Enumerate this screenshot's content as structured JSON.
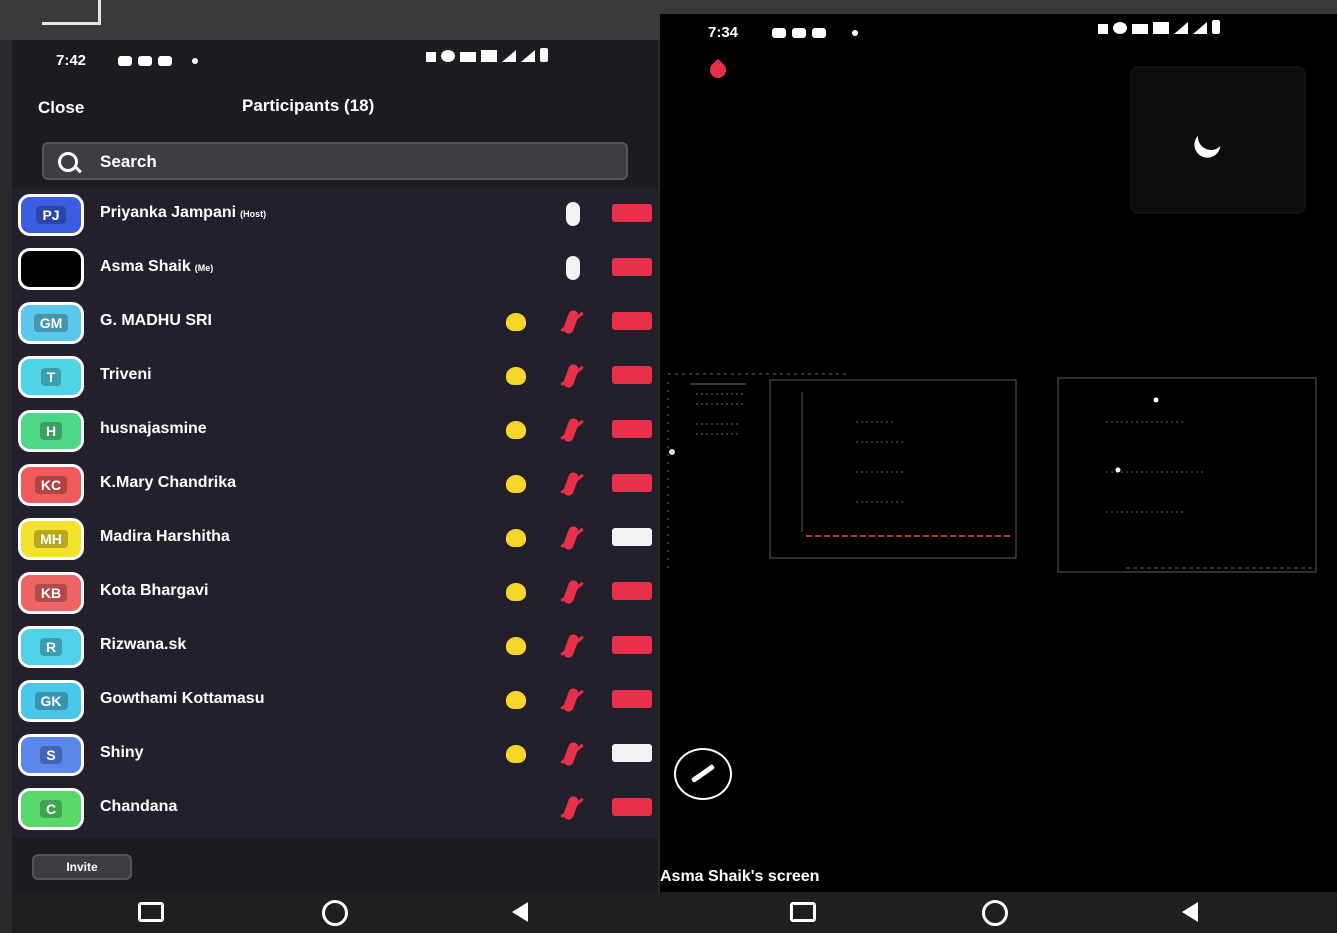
{
  "left_phone": {
    "status_time": "7:42",
    "close_label": "Close",
    "title": "Participants (18)",
    "search_placeholder": "Search",
    "invite_label": "Invite",
    "participants": [
      {
        "initials": "PJ",
        "name": "Priyanka Jampani",
        "tag": "(Host)",
        "avatar_color": "#3b5ee0",
        "hand": false,
        "mic": "on",
        "camera": "off"
      },
      {
        "initials": "",
        "name": "Asma Shaik",
        "tag": "(Me)",
        "avatar_color": "#000000",
        "hand": false,
        "mic": "on",
        "camera": "off"
      },
      {
        "initials": "GM",
        "name": "G. MADHU SRI",
        "tag": "",
        "avatar_color": "#5bc7ea",
        "hand": true,
        "mic": "off",
        "camera": "off"
      },
      {
        "initials": "T",
        "name": "Triveni",
        "tag": "",
        "avatar_color": "#4fd4e6",
        "hand": true,
        "mic": "off",
        "camera": "off"
      },
      {
        "initials": "H",
        "name": "husnajasmine",
        "tag": "",
        "avatar_color": "#4ed687",
        "hand": true,
        "mic": "off",
        "camera": "off"
      },
      {
        "initials": "KC",
        "name": "K.Mary Chandrika",
        "tag": "",
        "avatar_color": "#ef5a5a",
        "hand": true,
        "mic": "off",
        "camera": "off"
      },
      {
        "initials": "MH",
        "name": "Madira Harshitha",
        "tag": "",
        "avatar_color": "#f4e12e",
        "hand": true,
        "mic": "off",
        "camera": "on"
      },
      {
        "initials": "KB",
        "name": "Kota Bhargavi",
        "tag": "",
        "avatar_color": "#ef6464",
        "hand": true,
        "mic": "off",
        "camera": "off"
      },
      {
        "initials": "R",
        "name": "Rizwana.sk",
        "tag": "",
        "avatar_color": "#4fd2e8",
        "hand": true,
        "mic": "off",
        "camera": "off"
      },
      {
        "initials": "GK",
        "name": "Gowthami Kottamasu",
        "tag": "",
        "avatar_color": "#4ac6ea",
        "hand": true,
        "mic": "off",
        "camera": "off"
      },
      {
        "initials": "S",
        "name": "Shiny",
        "tag": "",
        "avatar_color": "#5b86ea",
        "hand": true,
        "mic": "off",
        "camera": "on"
      },
      {
        "initials": "C",
        "name": "Chandana",
        "tag": "",
        "avatar_color": "#58d86a",
        "hand": false,
        "mic": "off",
        "camera": "off"
      }
    ]
  },
  "right_phone": {
    "status_time": "7:34",
    "share_label": "Asma Shaik's screen"
  },
  "colors": {
    "red": "#e8304a",
    "hand": "#f6d62a",
    "panel": "#24202b"
  }
}
